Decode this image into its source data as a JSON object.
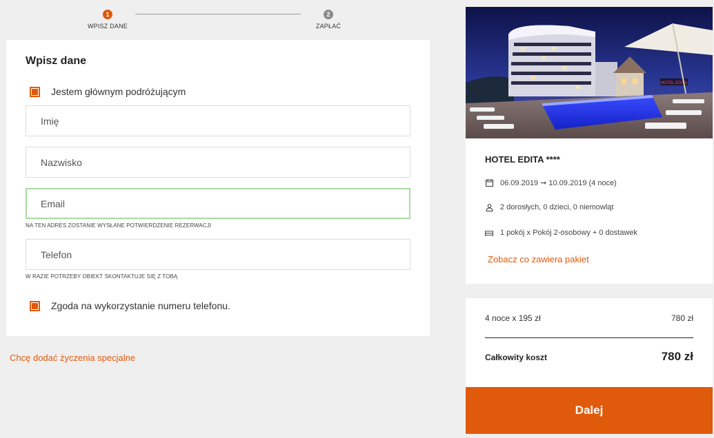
{
  "stepper": {
    "steps": [
      {
        "number": "1",
        "label": "WPISZ DANE",
        "active": true
      },
      {
        "number": "2",
        "label": "ZAPŁAĆ",
        "active": false
      }
    ]
  },
  "form": {
    "title": "Wpisz dane",
    "main_traveler_label": "Jestem głównym podróżującym",
    "main_traveler_checked": true,
    "first_name_placeholder": "Imię",
    "last_name_placeholder": "Nazwisko",
    "email_placeholder": "Email",
    "email_hint": "NA TEN ADRES ZOSTANIE WYSŁANE POTWIERDZENIE REZERWACJI",
    "phone_placeholder": "Telefon",
    "phone_hint": "W RAZIE POTRZEBY OBIEKT SKONTAKTUJE SIĘ Z TOBĄ",
    "phone_consent_label": "Zgoda na wykorzystanie numeru telefonu.",
    "phone_consent_checked": true
  },
  "special_requests_link": "Chcę dodać życzenia specjalne",
  "hotel": {
    "name": "HOTEL EDITA ****",
    "sign_text": "HOTEL EDITA",
    "dates": "06.09.2019 ➞ 10.09.2019 (4 noce)",
    "guests": "2 dorosłych, 0 dzieci, 0 niemowląt",
    "rooms": "1 pokój x Pokój 2-osobowy + 0 dostawek",
    "package_link": "Zobacz co zawiera pakiet",
    "icons": {
      "dates": "calendar-icon",
      "guests": "person-icon",
      "rooms": "bed-icon"
    }
  },
  "price": {
    "nights_label": "4 noce x 195 zł",
    "nights_value": "780 zł",
    "total_label": "Całkowity koszt",
    "total_value": "780 zł"
  },
  "next_button": "Dalej",
  "colors": {
    "accent": "#e05a0c",
    "step_inactive": "#8a8a8a",
    "focus_border": "#a8dba0",
    "background": "#efefef"
  }
}
